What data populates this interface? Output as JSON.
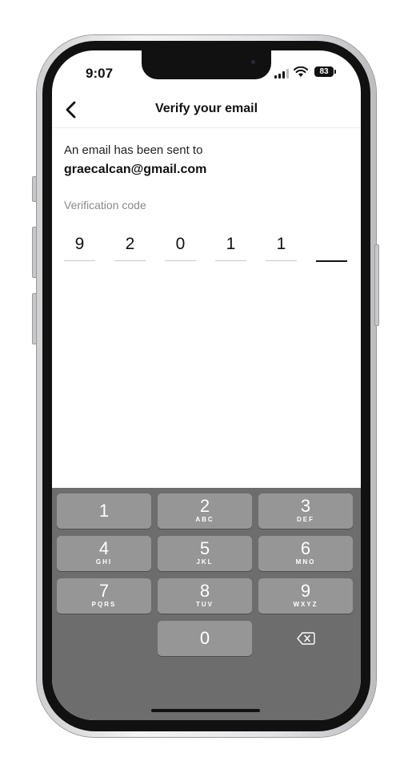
{
  "status_bar": {
    "time": "9:07",
    "battery": "83"
  },
  "nav": {
    "title": "Verify your email"
  },
  "body": {
    "sent_text": "An email has been sent to",
    "email": "graecalcan@gmail.com",
    "code_label": "Verification code",
    "code_digits": [
      "9",
      "2",
      "0",
      "1",
      "1",
      ""
    ]
  },
  "keypad": {
    "keys": [
      {
        "num": "1",
        "letters": ""
      },
      {
        "num": "2",
        "letters": "ABC"
      },
      {
        "num": "3",
        "letters": "DEF"
      },
      {
        "num": "4",
        "letters": "GHI"
      },
      {
        "num": "5",
        "letters": "JKL"
      },
      {
        "num": "6",
        "letters": "MNO"
      },
      {
        "num": "7",
        "letters": "PQRS"
      },
      {
        "num": "8",
        "letters": "TUV"
      },
      {
        "num": "9",
        "letters": "WXYZ"
      },
      {
        "num": "0",
        "letters": ""
      }
    ]
  },
  "icons": {
    "back": "chevron-left-icon",
    "delete": "backspace-icon",
    "wifi": "wifi-icon",
    "signal": "signal-icon"
  }
}
